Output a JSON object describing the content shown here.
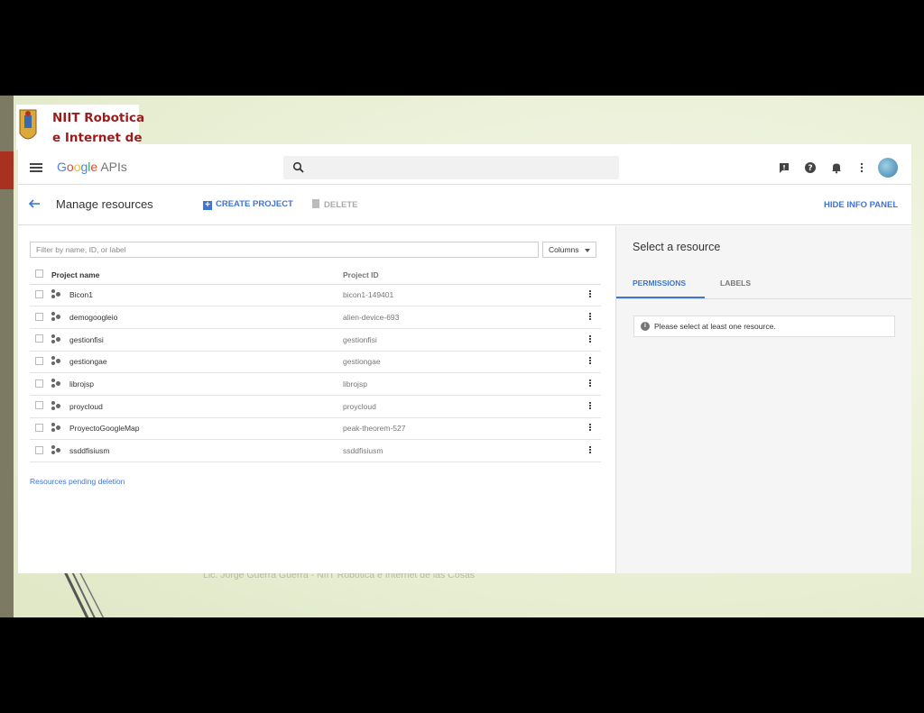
{
  "slide": {
    "logo_line1": "NIIT Robotica",
    "logo_line2": "e Internet de",
    "footer": "Lic. Jorge Guerra Guerra - NIIT Robotica e Internet de las Cosas"
  },
  "topbar": {
    "brand_letters": [
      "G",
      "o",
      "o",
      "g",
      "l",
      "e"
    ],
    "brand_suffix": " APIs",
    "icons": [
      "search-icon",
      "feedback-icon",
      "help-icon",
      "notifications-icon",
      "more-vert-icon"
    ]
  },
  "actionbar": {
    "title": "Manage resources",
    "create_label": "CREATE PROJECT",
    "delete_label": "DELETE",
    "hide_panel_label": "HIDE INFO PANEL"
  },
  "filter": {
    "placeholder": "Filter by name, ID, or label",
    "columns_label": "Columns"
  },
  "table": {
    "headers": {
      "name": "Project name",
      "id": "Project ID"
    },
    "rows": [
      {
        "name": "Bicon1",
        "id": "bicon1-149401"
      },
      {
        "name": "demogoogleio",
        "id": "alien-device-693"
      },
      {
        "name": "gestionfisi",
        "id": "gestionfisi"
      },
      {
        "name": "gestiongae",
        "id": "gestiongae"
      },
      {
        "name": "librojsp",
        "id": "librojsp"
      },
      {
        "name": "proycloud",
        "id": "proycloud"
      },
      {
        "name": "ProyectoGoogleMap",
        "id": "peak-theorem-527"
      },
      {
        "name": "ssddfisiusm",
        "id": "ssddfisiusm"
      }
    ],
    "pending_link": "Resources pending deletion"
  },
  "panel": {
    "title": "Select a resource",
    "tabs": [
      "PERMISSIONS",
      "LABELS"
    ],
    "notice": "Please select at least one resource."
  },
  "colors": {
    "accent": "#3f75d4",
    "logo_red": "#9b1c1c"
  }
}
